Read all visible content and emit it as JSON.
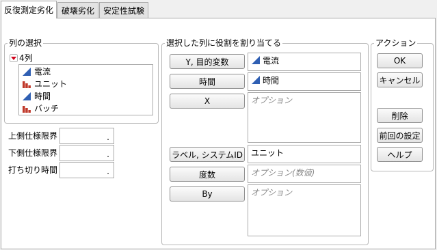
{
  "tabs": [
    {
      "label": "反復測定劣化"
    },
    {
      "label": "破壊劣化"
    },
    {
      "label": "安定性試験"
    }
  ],
  "column_select": {
    "title": "列の選択",
    "count_label": "4列",
    "items": [
      {
        "label": "電流",
        "icon": "continuous-icon"
      },
      {
        "label": "ユニット",
        "icon": "nominal-icon"
      },
      {
        "label": "時間",
        "icon": "continuous-icon"
      },
      {
        "label": "バッチ",
        "icon": "nominal-icon"
      }
    ]
  },
  "limits": {
    "upper_label": "上側仕様限界",
    "lower_label": "下側仕様限界",
    "censor_label": "打ち切り時間",
    "upper_value": ".",
    "lower_value": ".",
    "censor_value": "."
  },
  "roles": {
    "title": "選択した列に役割を割り当てる",
    "y_button": "Y, 目的変数",
    "y_value": "電流",
    "time_button": "時間",
    "time_value": "時間",
    "x_button": "X",
    "x_placeholder": "オプション",
    "label_button": "ラベル, システムID",
    "label_value": "ユニット",
    "freq_button": "度数",
    "freq_placeholder": "オプション(数値)",
    "by_button": "By",
    "by_placeholder": "オプション"
  },
  "actions": {
    "title": "アクション",
    "ok": "OK",
    "cancel": "キャンセル",
    "remove": "削除",
    "recall": "前回の設定",
    "help": "ヘルプ"
  },
  "colors": {
    "continuous": "#2f5fb3",
    "nominal": "#c0392b",
    "disclosure": "#d0021b"
  }
}
